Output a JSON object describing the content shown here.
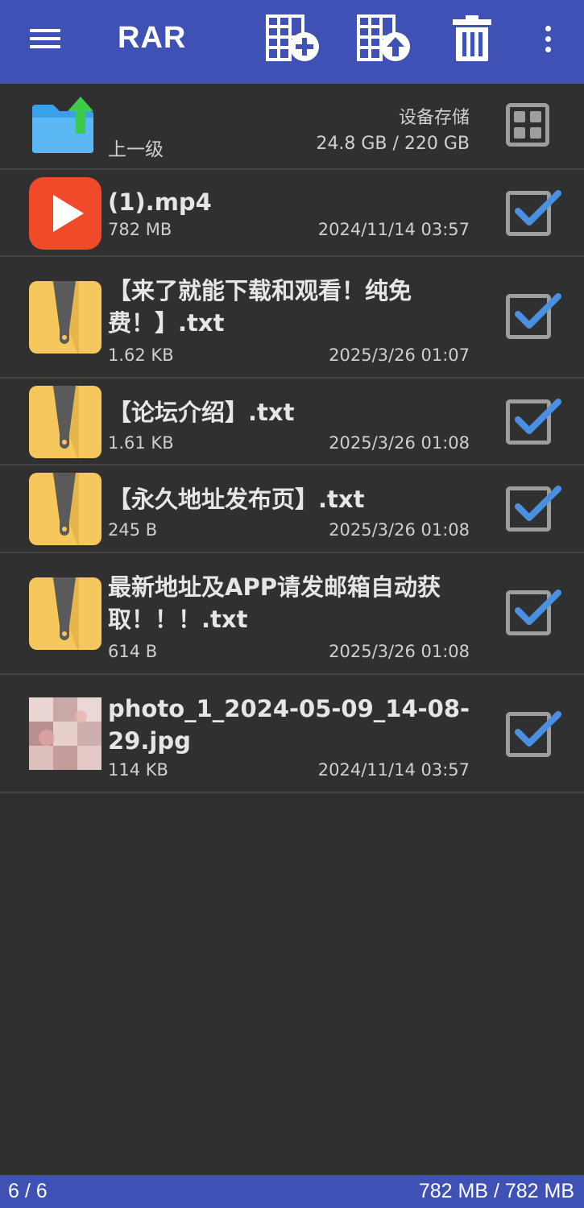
{
  "appbar": {
    "title": "RAR",
    "icons": [
      "menu-icon",
      "add-to-archive-icon",
      "extract-icon",
      "trash-icon",
      "more-vert-icon"
    ]
  },
  "parent": {
    "label": "上一级",
    "storage_label": "设备存储",
    "storage_size": "24.8 GB / 220 GB"
  },
  "files": [
    {
      "name": " (1).mp4",
      "size": "782 MB",
      "date": "2024/11/14 03:57",
      "type": "video",
      "checked": true
    },
    {
      "name": "【来了就能下载和观看！纯免费！】.txt",
      "size": "1.62 KB",
      "date": "2025/3/26 01:07",
      "type": "archive",
      "checked": true
    },
    {
      "name": "【论坛介绍】.txt",
      "size": "1.61 KB",
      "date": "2025/3/26 01:08",
      "type": "archive",
      "checked": true
    },
    {
      "name": "【永久地址发布页】.txt",
      "size": "245 B",
      "date": "2025/3/26 01:08",
      "type": "archive",
      "checked": true
    },
    {
      "name": "最新地址及APP请发邮箱自动获取！！！.txt",
      "size": "614 B",
      "date": "2025/3/26 01:08",
      "type": "archive",
      "checked": true
    },
    {
      "name": "photo_1_2024-05-09_14-08-29.jpg",
      "size": "114 KB",
      "date": "2024/11/14 03:57",
      "type": "image",
      "checked": true
    }
  ],
  "status": {
    "count": "6 / 6",
    "total": "782 MB / 782 MB"
  },
  "colors": {
    "accent": "#3f51b5",
    "background": "#303030",
    "check": "#4a90e2"
  }
}
